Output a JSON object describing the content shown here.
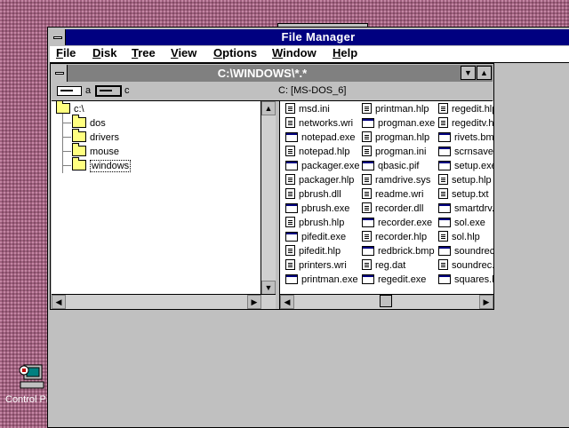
{
  "desktop": {
    "icon_label": "Control Panel"
  },
  "app": {
    "title": "File Manager",
    "menu": [
      {
        "text": "File",
        "u": "F"
      },
      {
        "text": "Disk",
        "u": "D"
      },
      {
        "text": "Tree",
        "u": "T"
      },
      {
        "text": "View",
        "u": "V"
      },
      {
        "text": "Options",
        "u": "O"
      },
      {
        "text": "Window",
        "u": "W"
      },
      {
        "text": "Help",
        "u": "H"
      }
    ]
  },
  "dir_window": {
    "title": "C:\\WINDOWS\\*.*",
    "drives": [
      {
        "letter": "a",
        "selected": false
      },
      {
        "letter": "c",
        "selected": true
      }
    ],
    "volume_label": "C: [MS-DOS_6]",
    "tree": [
      {
        "label": "c:\\",
        "level": 0,
        "open": true,
        "selected": false
      },
      {
        "label": "dos",
        "level": 1,
        "open": false,
        "selected": false
      },
      {
        "label": "drivers",
        "level": 1,
        "open": false,
        "selected": false
      },
      {
        "label": "mouse",
        "level": 1,
        "open": false,
        "selected": false
      },
      {
        "label": "windows",
        "level": 1,
        "open": true,
        "selected": true
      }
    ],
    "files": [
      [
        "msd.ini",
        "networks.wri",
        "notepad.exe",
        "notepad.hlp",
        "packager.exe",
        "packager.hlp",
        "pbrush.dll",
        "pbrush.exe",
        "pbrush.hlp",
        "pifedit.exe",
        "pifedit.hlp",
        "printers.wri",
        "printman.exe"
      ],
      [
        "printman.hlp",
        "progman.exe",
        "progman.hlp",
        "progman.ini",
        "qbasic.pif",
        "ramdrive.sys",
        "readme.wri",
        "recorder.dll",
        "recorder.exe",
        "recorder.hlp",
        "redbrick.bmp",
        "reg.dat",
        "regedit.exe"
      ],
      [
        "regedit.hlp",
        "regeditv.hlp",
        "rivets.bmp",
        "scrnsave.scr",
        "setup.exe",
        "setup.hlp",
        "setup.txt",
        "smartdrv.exe",
        "sol.exe",
        "sol.hlp",
        "soundrec.exe",
        "soundrec.hlp",
        "squares.bmp"
      ]
    ]
  }
}
